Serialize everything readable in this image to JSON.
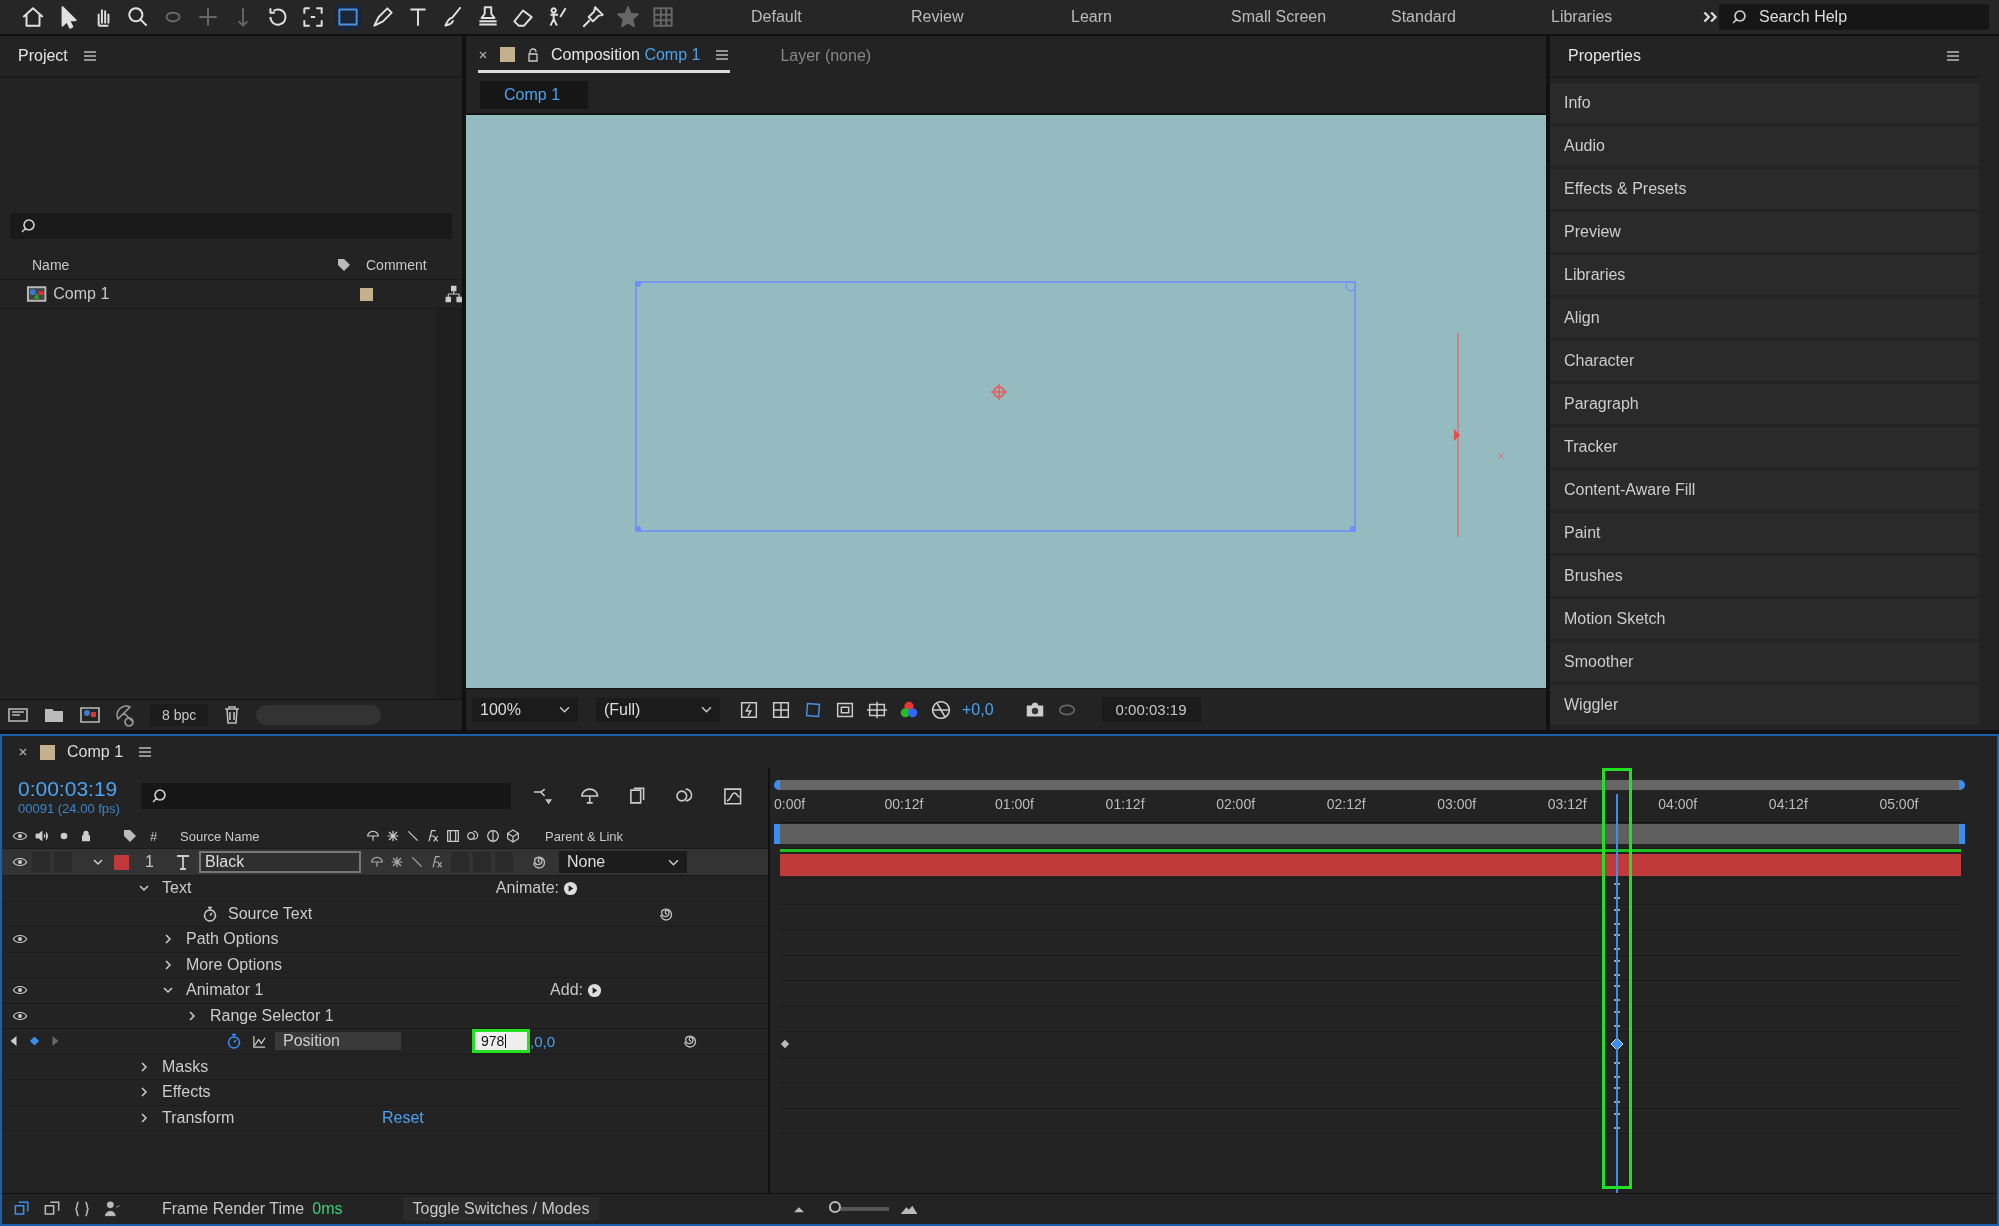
{
  "toolbar": {
    "workspaces": [
      "Default",
      "Review",
      "Learn",
      "Small Screen",
      "Standard",
      "Libraries"
    ],
    "search": {
      "placeholder": "Search Help"
    }
  },
  "project": {
    "title": "Project",
    "columns": [
      "Name",
      "Comment"
    ],
    "items": [
      {
        "name": "Comp 1",
        "color": "#c4b08c"
      }
    ],
    "bit_depth": "8 bpc"
  },
  "composition": {
    "tabs": [
      {
        "label": "Composition",
        "name": "Comp 1",
        "selected": true
      },
      {
        "label": "Layer (none)",
        "selected": false
      }
    ],
    "breadcrumb": "Comp 1",
    "zoom": "100%",
    "resolution": "(Full)",
    "exposure": "+0,0",
    "timecode": "0:00:03:19"
  },
  "properties": {
    "title": "Properties",
    "items": [
      "Info",
      "Audio",
      "Effects & Presets",
      "Preview",
      "Libraries",
      "Align",
      "Character",
      "Paragraph",
      "Tracker",
      "Content-Aware Fill",
      "Paint",
      "Brushes",
      "Motion Sketch",
      "Smoother",
      "Wiggler"
    ]
  },
  "timeline": {
    "title": "Comp 1",
    "color": "#c4b08c",
    "timecode": "0:00:03:19",
    "frame_info": "00091 (24.00 fps)",
    "columns": {
      "number": "#",
      "source_name": "Source Name",
      "parent": "Parent & Link"
    },
    "ruler": [
      "0:00f",
      "00:12f",
      "01:00f",
      "01:12f",
      "02:00f",
      "02:12f",
      "03:00f",
      "03:12f",
      "04:00f",
      "04:12f",
      "05:00f"
    ],
    "playhead": {
      "level": 0.709
    },
    "layers": [
      {
        "number": "1",
        "name": "Black",
        "color": "#c0393b",
        "parent": "None",
        "expanded": true,
        "children": [
          {
            "kind": "group",
            "name": "Text",
            "expanded": true,
            "action": "Animate:",
            "children": [
              {
                "kind": "property",
                "name": "Source Text",
                "animated": false
              },
              {
                "kind": "group",
                "name": "Path Options",
                "expanded": false,
                "eye": true
              },
              {
                "kind": "group",
                "name": "More Options",
                "expanded": false
              },
              {
                "kind": "group",
                "name": "Animator 1",
                "expanded": true,
                "eye": true,
                "action": "Add:",
                "children": [
                  {
                    "kind": "group",
                    "name": "Range Selector 1",
                    "expanded": false,
                    "eye": true
                  },
                  {
                    "kind": "property",
                    "name": "Position",
                    "animated": true,
                    "value": "978",
                    "value_rest": ",0,0"
                  }
                ]
              }
            ]
          },
          {
            "kind": "group",
            "name": "Masks",
            "expanded": false
          },
          {
            "kind": "group",
            "name": "Effects",
            "expanded": false
          },
          {
            "kind": "group",
            "name": "Transform",
            "expanded": false,
            "link": "Reset"
          }
        ]
      }
    ]
  },
  "status": {
    "label": "Frame Render Time",
    "value": "0ms",
    "toggle": "Toggle Switches / Modes",
    "zoom": {
      "level": 0.1
    }
  }
}
